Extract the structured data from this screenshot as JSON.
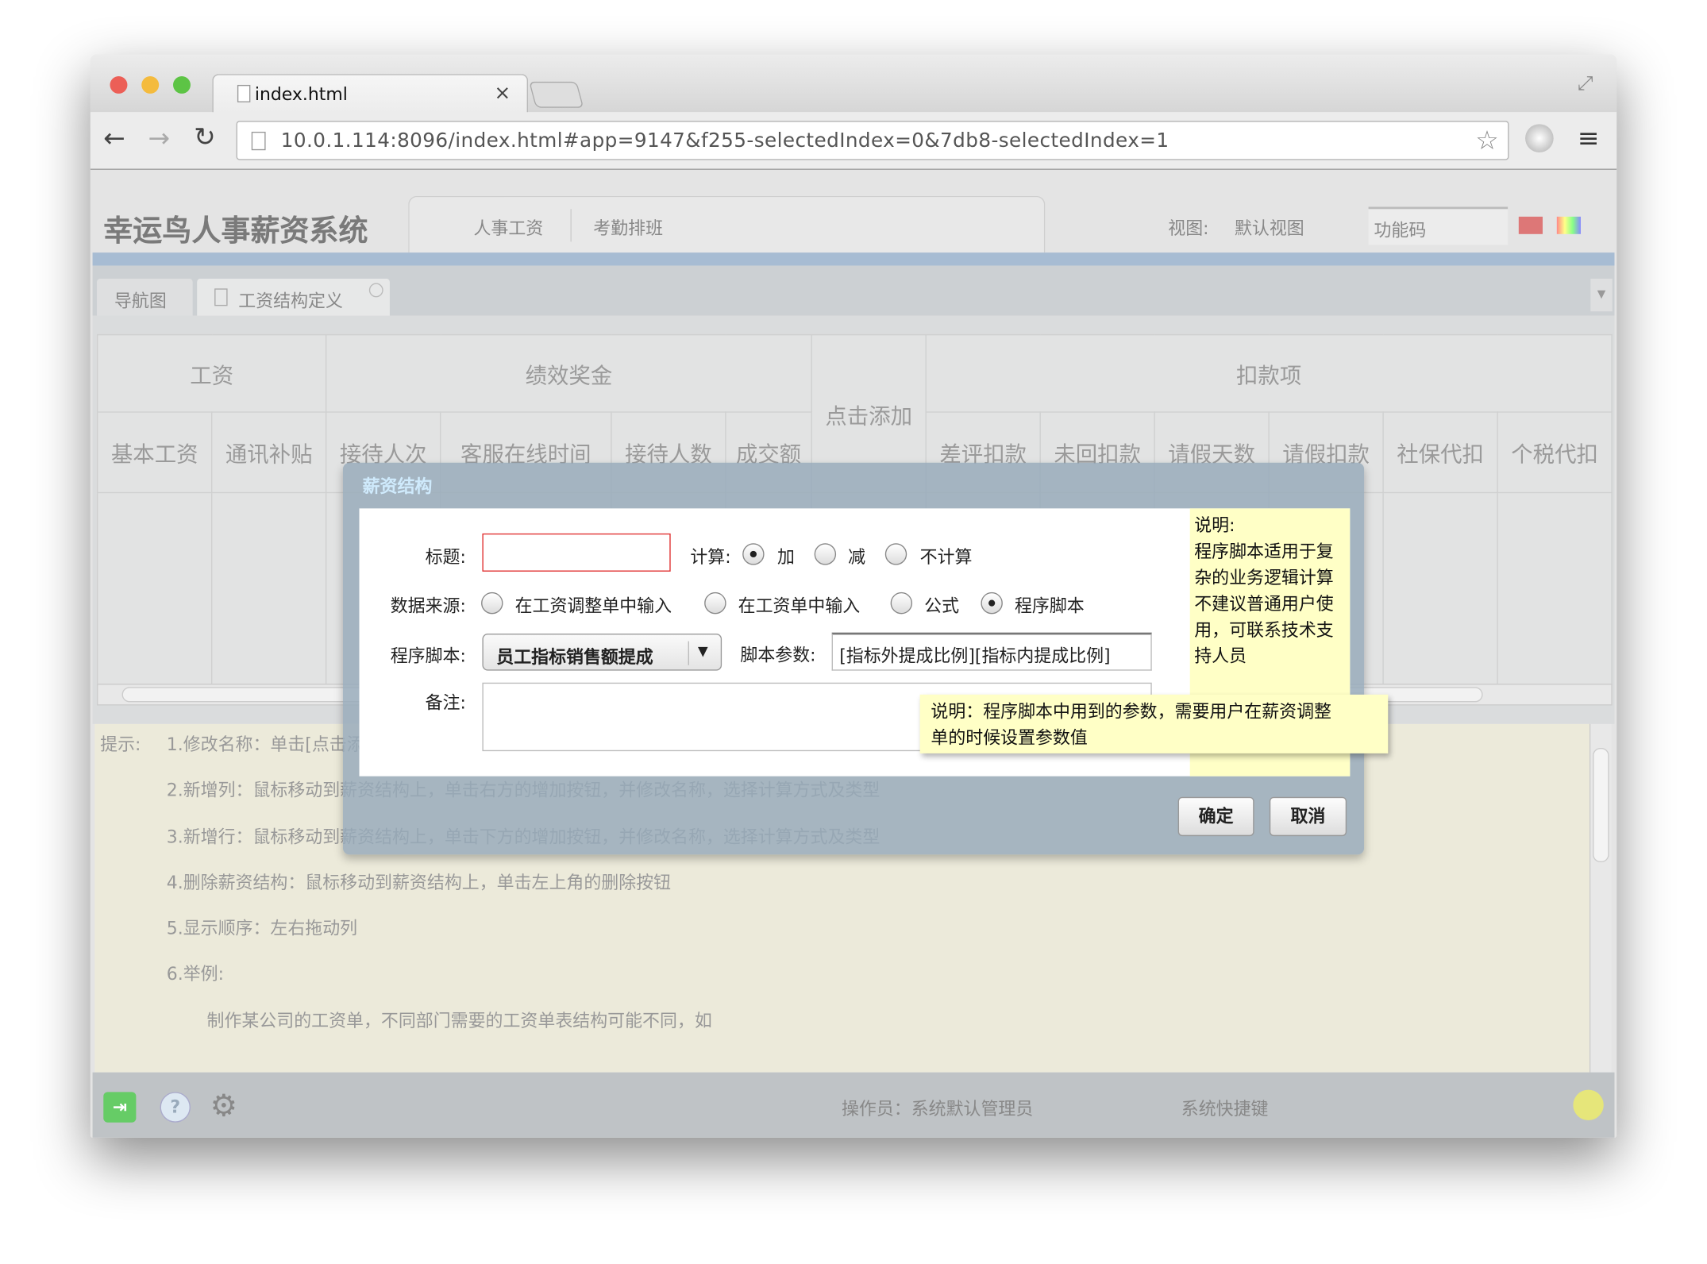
{
  "browser": {
    "tab_title": "index.html",
    "tab_close": "×",
    "url": "10.0.1.114:8096/index.html#app=9147&f255-selectedIndex=0&7db8-selectedIndex=1"
  },
  "app": {
    "title": "幸运鸟人事薪资系统",
    "nav": [
      "人事工资",
      "考勤排班"
    ],
    "view_label": "视图:",
    "view_value": "默认视图",
    "func_code_placeholder": "功能码"
  },
  "tabs": [
    {
      "label": "导航图"
    },
    {
      "label": "工资结构定义"
    }
  ],
  "grid": {
    "groups": [
      "工资",
      "绩效奖金",
      "点击添加",
      "扣款项"
    ],
    "columns": [
      "基本工资",
      "通讯补贴",
      "接待人次",
      "客服在线时间",
      "接待人数",
      "成交额",
      "差评扣款",
      "未回扣款",
      "请假天数",
      "请假扣款",
      "社保代扣",
      "个税代扣"
    ]
  },
  "hints": {
    "label": "提示:",
    "items": [
      "1.修改名称：单击[点击添加]，修改标题",
      "2.新增列：鼠标移动到薪资结构上，单击右方的增加按钮，并修改名称，选择计算方式及类型",
      "3.新增行：鼠标移动到薪资结构上，单击下方的增加按钮，并修改名称，选择计算方式及类型",
      "4.删除薪资结构：鼠标移动到薪资结构上，单击左上角的删除按钮",
      "5.显示顺序：左右拖动列",
      "6.举例:"
    ],
    "example": "制作某公司的工资单，不同部门需要的工资单表结构可能不同，如"
  },
  "footer": {
    "operator": "操作员：系统默认管理员",
    "shortcuts": "系统快捷键"
  },
  "dialog": {
    "title": "薪资结构",
    "title_label": "标题:",
    "title_value": "",
    "calc_label": "计算:",
    "calc_options": [
      "加",
      "减",
      "不计算"
    ],
    "calc_selected": "加",
    "source_label": "数据来源:",
    "source_options": [
      "在工资调整单中输入",
      "在工资单中输入",
      "公式",
      "程序脚本"
    ],
    "source_selected": "程序脚本",
    "script_label": "程序脚本:",
    "script_value": "员工指标销售额提成",
    "params_label": "脚本参数:",
    "params_value": "[指标外提成比例][指标内提成比例]",
    "remark_label": "备注:",
    "remark_value": "",
    "note": [
      "说明:",
      "程序脚本适用于复",
      "杂的业务逻辑计算",
      "不建议普通用户使",
      "用，可联系技术支",
      "持人员"
    ],
    "tooltip": [
      "说明：程序脚本中用到的参数，需要用户在薪资调整",
      "单的时候设置参数值"
    ],
    "ok": "确定",
    "cancel": "取消"
  },
  "colors": {
    "accent_bar": "#a7bcd3",
    "hint_bg": "#eceada",
    "note_bg": "#ffffc6",
    "error_border": "#e03030"
  }
}
